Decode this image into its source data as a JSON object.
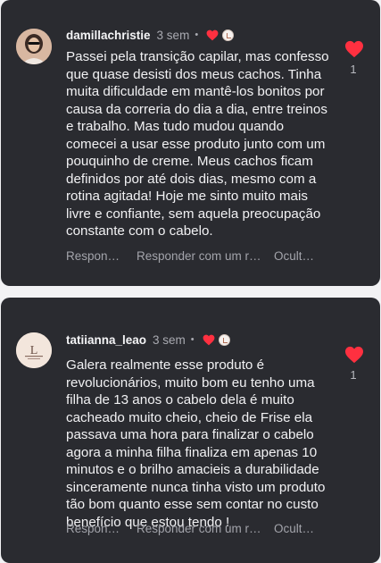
{
  "comments": [
    {
      "username": "damillachristie",
      "time": "3 sem",
      "separator": "•",
      "text": "Passei pela transição capilar, mas confesso que quase desisti dos meus cachos. Tinha muita dificuldade em mantê-los bonitos por causa da correria do dia a dia, entre treinos e trabalho. Mas tudo mudou quando comecei a usar esse produto junto com um pouquinho de creme. Meus cachos ficam definidos por até dois dias, mesmo com a rotina agitada! Hoje me sinto muito mais livre e confiante, sem aquela preocupação constante com o cabelo.",
      "actions": [
        "Respon…",
        "Responder com um r…",
        "Ocult…"
      ],
      "likes": "1",
      "heart_color": "#ff3040"
    },
    {
      "username": "tatiianna_leao",
      "time": "3 sem",
      "separator": "•",
      "text": "Galera realmente esse produto é revolucionários,  muito bom eu tenho uma filha de 13 anos o cabelo dela é muito cacheado muito cheio, cheio de Frise ela passava uma hora para finalizar o cabelo agora a minha filha finaliza em apenas 10 minutos e o brilho amacieis a durabilidade sinceramente nunca tinha visto um produto tão bom quanto esse sem contar no custo benefício que estou tendo !",
      "actions": [
        "Respon…",
        "Responder com um r…",
        "Ocult…"
      ],
      "likes": "1",
      "heart_color": "#ff3040"
    }
  ],
  "icons": {
    "like": "heart-icon",
    "creator_like": "heart-icon",
    "creator_avatar": "avatar"
  }
}
